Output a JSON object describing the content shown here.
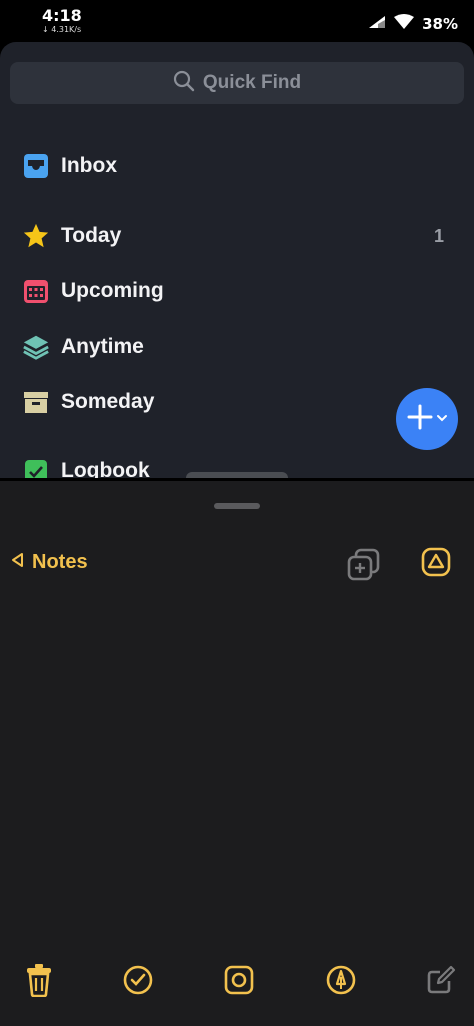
{
  "status": {
    "time": "4:18",
    "net_speed": "↓ 4.31K/s",
    "battery": "38%"
  },
  "things": {
    "search_placeholder": "Quick Find",
    "items": [
      {
        "label": "Inbox",
        "icon": "inbox-icon",
        "color": "#4aa3f0"
      },
      {
        "label": "Today",
        "icon": "star-icon",
        "color": "#f5c518",
        "count": "1"
      },
      {
        "label": "Upcoming",
        "icon": "calendar-icon",
        "color": "#f0506e"
      },
      {
        "label": "Anytime",
        "icon": "layers-icon",
        "color": "#6fc2b4"
      },
      {
        "label": "Someday",
        "icon": "archive-box-icon",
        "color": "#d8cfa3"
      },
      {
        "label": "Logbook",
        "icon": "logbook-check-icon",
        "color": "#3fbf5a"
      }
    ],
    "fab_color": "#3b82f6"
  },
  "notes": {
    "back_label": "Notes",
    "accent": "#f2c14e"
  }
}
